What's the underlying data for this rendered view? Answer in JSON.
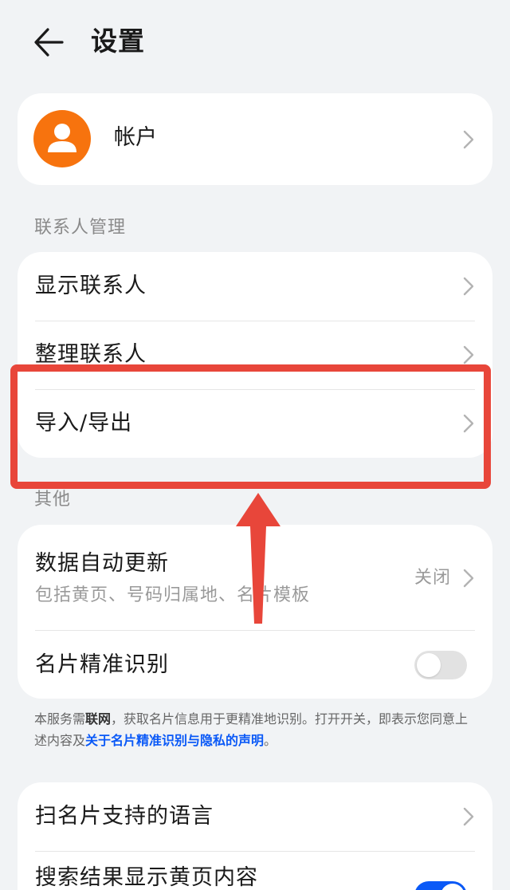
{
  "header": {
    "back_label": "返回",
    "title": "设置"
  },
  "account": {
    "label": "帐户"
  },
  "contact_management": {
    "section_title": "联系人管理",
    "items": [
      {
        "label": "显示联系人"
      },
      {
        "label": "整理联系人"
      },
      {
        "label": "导入/导出"
      }
    ]
  },
  "other": {
    "section_title": "其他",
    "auto_update": {
      "label": "数据自动更新",
      "subtitle": "包括黄页、号码归属地、名片模板",
      "value": "关闭"
    },
    "card_recognition": {
      "label": "名片精准识别",
      "toggle_on": false
    }
  },
  "note": {
    "part1": "本服务需",
    "bold": "联网",
    "part2": "，获取名片信息用于更精准地识别。打开开关，即表示您同意上述内容及",
    "link": "关于名片精准识别与隐私的声明",
    "part3": "。"
  },
  "more": {
    "items": [
      {
        "label": "扫名片支持的语言"
      },
      {
        "label": "搜索结果显示黄页内容",
        "toggle_on": true
      }
    ]
  },
  "colors": {
    "accent": "#0a59f7",
    "avatar": "#f7730e",
    "highlight": "#e8463a",
    "background": "#f1f3f5"
  },
  "icons": {
    "back": "arrow-left-icon",
    "avatar": "person-icon",
    "chevron": "chevron-right-icon",
    "annotation": "red-arrow-up"
  }
}
